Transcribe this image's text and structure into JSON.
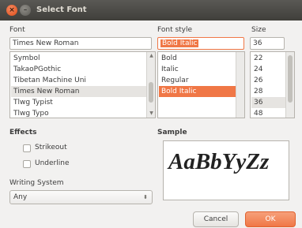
{
  "window": {
    "title": "Select Font",
    "close_glyph": "×",
    "minimize_glyph": "–"
  },
  "font": {
    "label": "Font",
    "value": "Times New Roman",
    "items": [
      "Symbol",
      "TakaoPGothic",
      "Tibetan Machine Uni",
      "Times New Roman",
      "Tlwg Typist",
      "Tlwg Typo"
    ],
    "selected_index": 3
  },
  "style": {
    "label": "Font style",
    "value": "Bold Italic",
    "items": [
      "Bold",
      "Italic",
      "Regular",
      "Bold Italic"
    ],
    "selected_index": 3
  },
  "size": {
    "label": "Size",
    "value": "36",
    "items": [
      "22",
      "24",
      "26",
      "28",
      "36",
      "48"
    ],
    "highlighted_index": 4
  },
  "effects": {
    "heading": "Effects",
    "strikeout": {
      "label": "Strikeout",
      "checked": false
    },
    "underline": {
      "label": "Underline",
      "checked": false
    }
  },
  "writing_system": {
    "label": "Writing System",
    "value": "Any"
  },
  "sample": {
    "heading": "Sample",
    "text": "AaBbYyZz"
  },
  "buttons": {
    "cancel": "Cancel",
    "ok": "OK"
  },
  "colors": {
    "accent": "#f07746",
    "titlebar": "#403f3b",
    "background": "#f2f1f0"
  },
  "icons": {
    "close": "close-icon",
    "minimize": "minimize-icon",
    "scroll_up": "chevron-up-icon",
    "scroll_down": "chevron-down-icon",
    "combo_caret": "updown-caret-icon"
  }
}
